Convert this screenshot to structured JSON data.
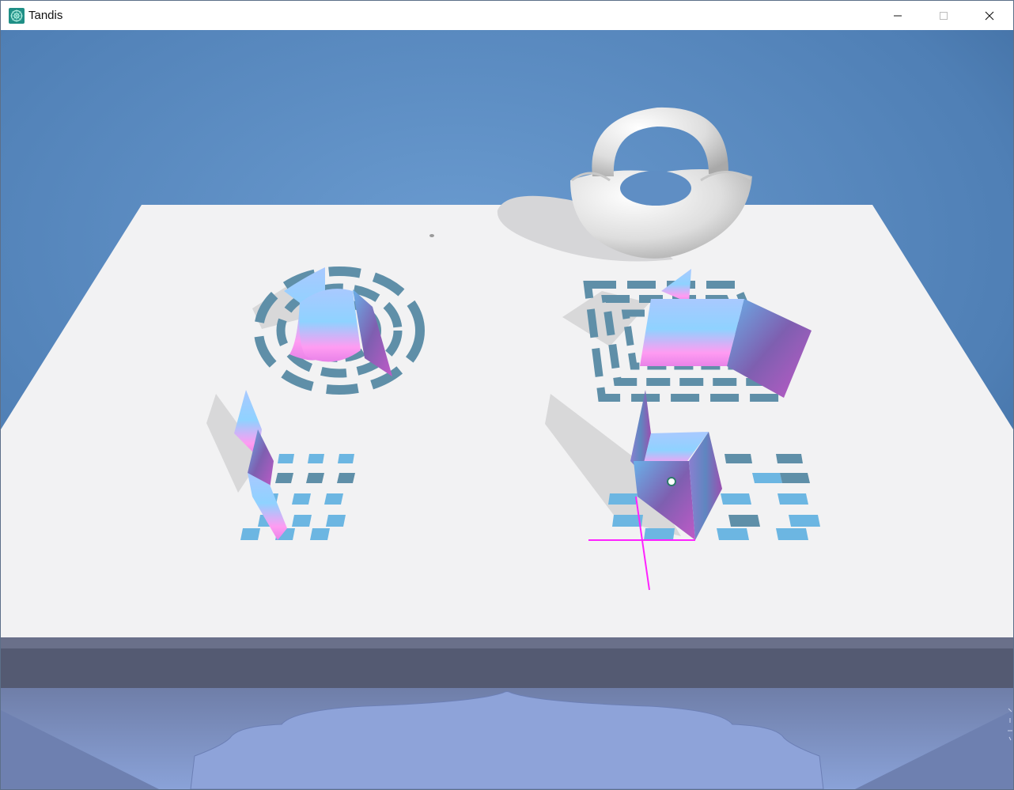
{
  "window": {
    "title": "Tandis",
    "controls": {
      "minimize": "minimize",
      "maximize": "maximize",
      "close": "close"
    }
  },
  "scene": {
    "background_top": "#3f6da3",
    "background_center": "#6a9bd0",
    "table_color": "#f2f2f3",
    "surface_gradient_top": "#b7d4ff",
    "surface_gradient_mid": "#ff9cf2",
    "surface_gradient_dark": "#7a4f9a",
    "pattern_color": "#5f8fa8",
    "checker_color": "#6cb6e2",
    "cursor_axis_color": "#ff22ff",
    "reflection_color": "#8aa2d8"
  }
}
